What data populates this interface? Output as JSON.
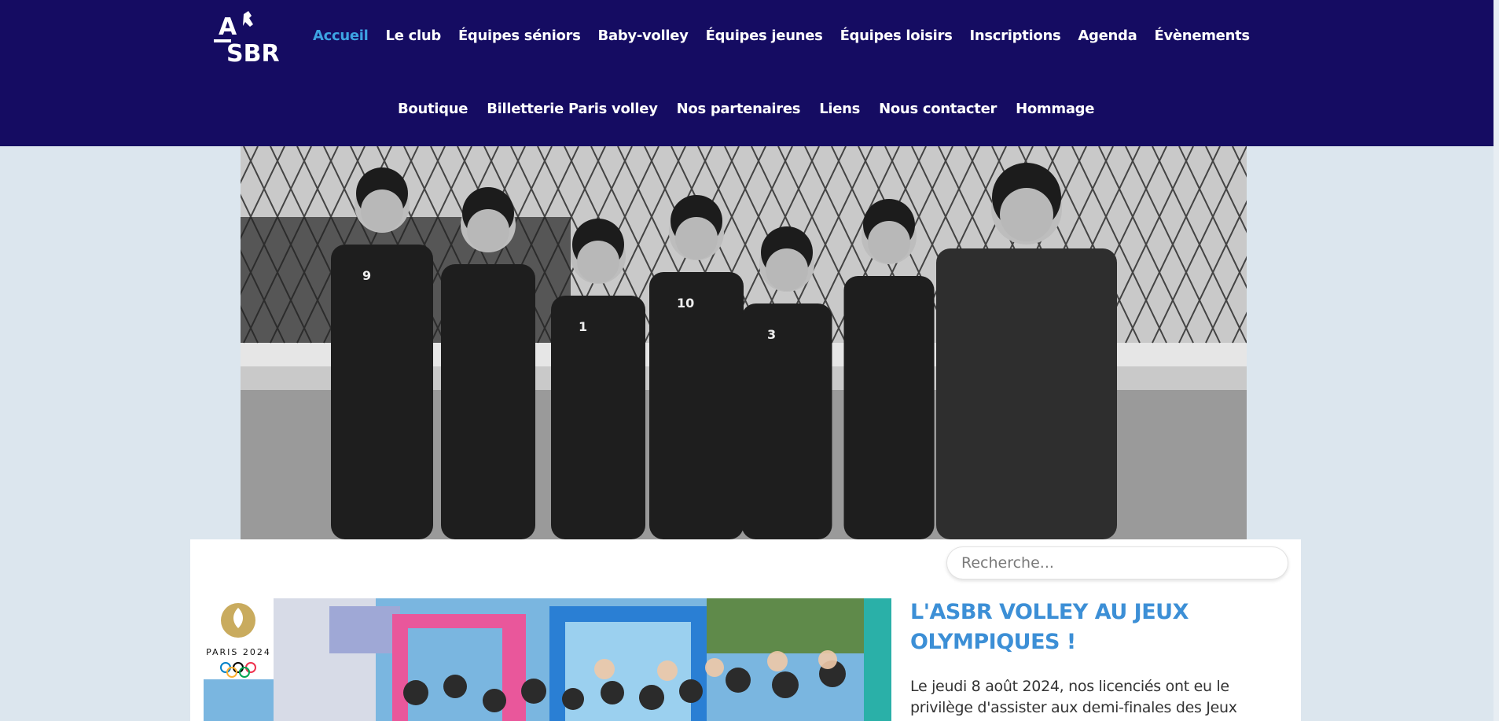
{
  "brand": {
    "logo_text_top": "A",
    "logo_text_bottom": "SBR"
  },
  "nav": {
    "row1": [
      {
        "label": "Accueil",
        "active": true
      },
      {
        "label": "Le club"
      },
      {
        "label": "Équipes séniors"
      },
      {
        "label": "Baby-volley"
      },
      {
        "label": "Équipes jeunes"
      },
      {
        "label": "Équipes loisirs"
      },
      {
        "label": "Inscriptions"
      },
      {
        "label": "Agenda"
      },
      {
        "label": "Évènements"
      }
    ],
    "row2": [
      {
        "label": "Boutique"
      },
      {
        "label": "Billetterie Paris volley"
      },
      {
        "label": "Nos partenaires"
      },
      {
        "label": "Liens"
      },
      {
        "label": "Nous contacter"
      },
      {
        "label": "Hommage"
      }
    ]
  },
  "hero": {
    "jersey_numbers": [
      "9",
      "",
      "1",
      "10",
      "3",
      "",
      ""
    ]
  },
  "search": {
    "placeholder": "Recherche..."
  },
  "post": {
    "badge_text": "PARIS 2024",
    "title": "L'ASBR VOLLEY AU JEUX OLYMPIQUES !",
    "excerpt": "Le jeudi 8 août 2024, nos licenciés ont eu le privilège d'assister aux demi-finales des Jeux"
  },
  "colors": {
    "navbar_bg": "#150c62",
    "nav_active": "#3da3e3",
    "page_bg": "#dce6ee",
    "title_blue": "#3c8fd6"
  }
}
